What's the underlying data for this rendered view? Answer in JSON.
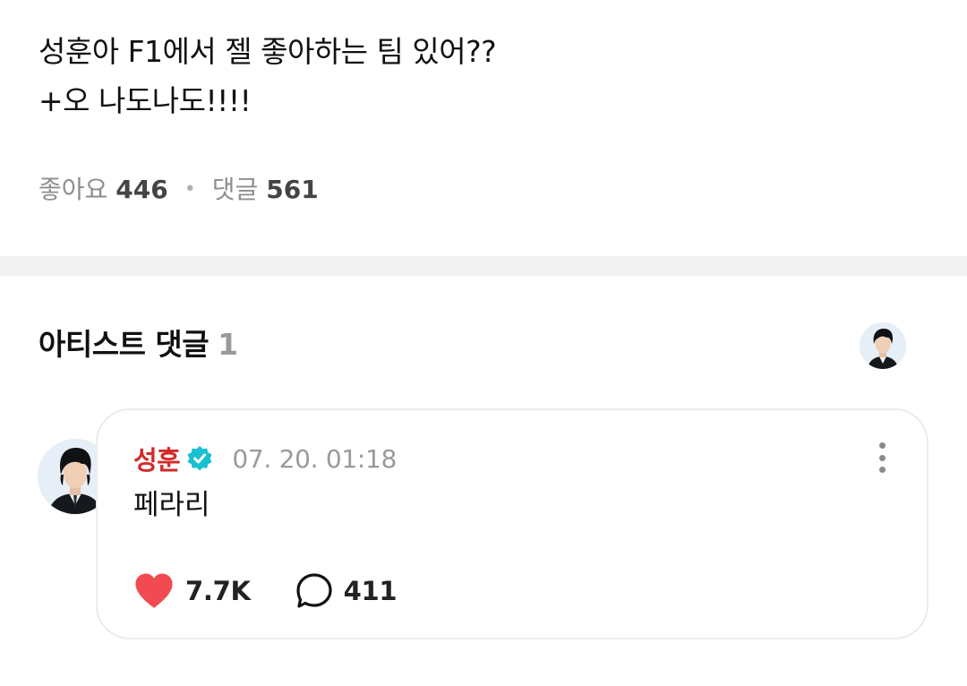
{
  "post": {
    "lines": [
      "성훈아 F1에서 젤 좋아하는 팀 있어??",
      "+오 나도나도!!!!"
    ],
    "likes_label": "좋아요",
    "likes_count": "446",
    "comments_label": "댓글",
    "comments_count": "561"
  },
  "artist_comments": {
    "title": "아티스트 댓글",
    "count": "1"
  },
  "comment": {
    "author": "성훈",
    "timestamp": "07. 20. 01:18",
    "text": "페라리",
    "like_count": "7.7K",
    "reply_count": "411",
    "icons": [
      "verified-badge-icon",
      "more-vertical-icon",
      "heart-icon",
      "speech-bubble-icon"
    ]
  },
  "colors": {
    "author": "#d42a2a",
    "heart": "#f24a52",
    "verified": "#19c0cf",
    "muted": "#9a9a9a",
    "divider": "#f2f2f2"
  }
}
